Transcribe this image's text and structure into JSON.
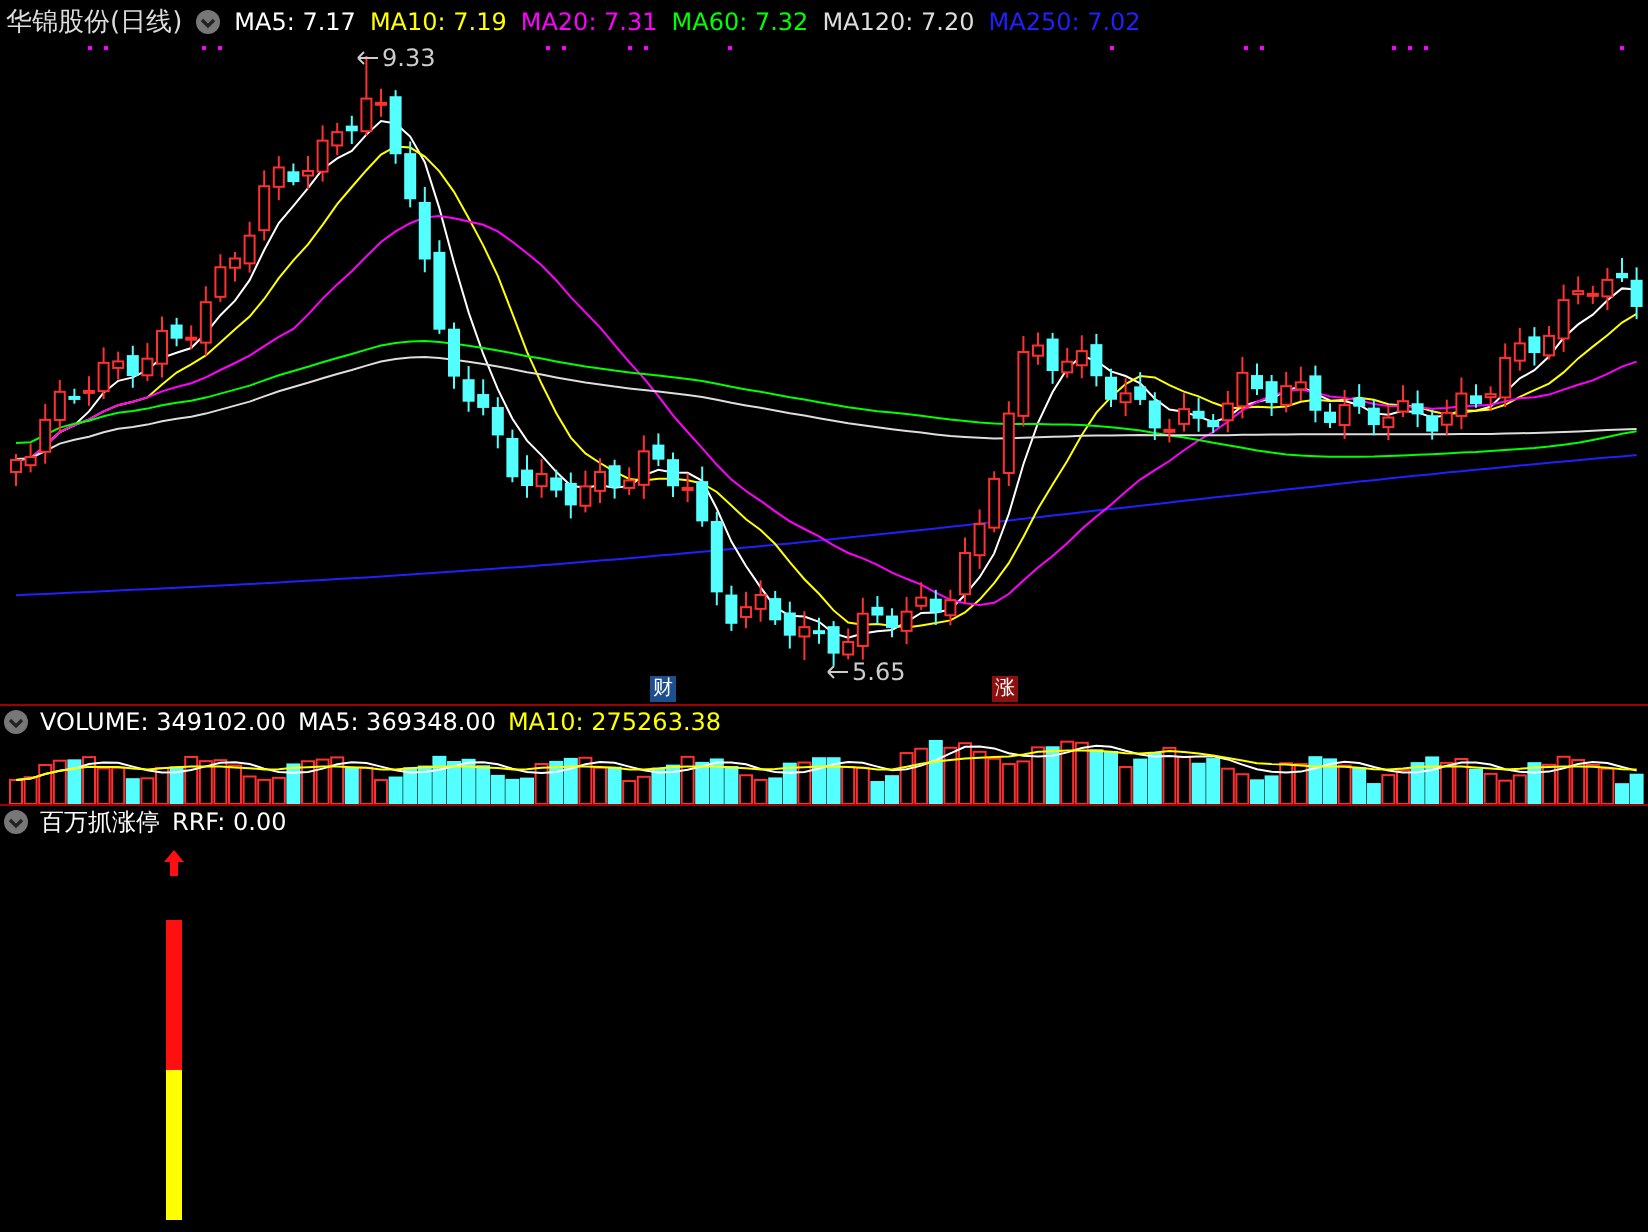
{
  "header": {
    "title": "华锦股份(日线)",
    "indicators": [
      {
        "label": "MA5: 7.17",
        "color": "#ffffff"
      },
      {
        "label": "MA10: 7.19",
        "color": "#ffff00"
      },
      {
        "label": "MA20: 7.31",
        "color": "#ff00ff"
      },
      {
        "label": "MA60: 7.32",
        "color": "#00ff00"
      },
      {
        "label": "MA120: 7.20",
        "color": "#dddddd"
      },
      {
        "label": "MA250: 7.02",
        "color": "#2020ff"
      }
    ]
  },
  "chart_markers": {
    "high": "9.33",
    "low": "5.65"
  },
  "event_badges": [
    {
      "text": "财",
      "kind": "finance"
    },
    {
      "text": "涨",
      "kind": "limit"
    }
  ],
  "volume_header": {
    "items": [
      {
        "label": "VOLUME: 349102.00",
        "color": "#ffffff"
      },
      {
        "label": "MA5: 369348.00",
        "color": "#ffffff"
      },
      {
        "label": "MA10: 275263.38",
        "color": "#ffff00"
      }
    ]
  },
  "indicator_header": {
    "title": "百万抓涨停",
    "items": [
      {
        "label": "RRF: 0.00",
        "color": "#ffffff"
      }
    ]
  }
}
